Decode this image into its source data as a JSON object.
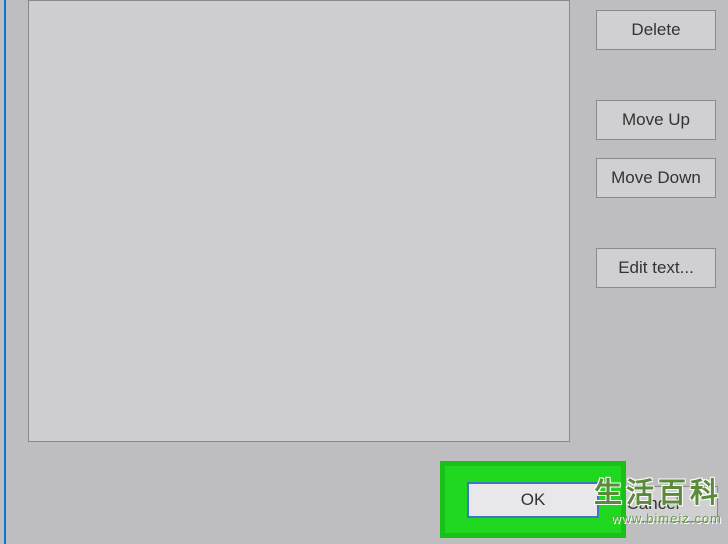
{
  "buttons": {
    "delete": "Delete",
    "moveUp": "Move Up",
    "moveDown": "Move Down",
    "editText": "Edit text...",
    "ok": "OK",
    "cancel": "Cancel"
  },
  "watermark": {
    "main": "生活百科",
    "url": "www.bimeiz.com"
  }
}
